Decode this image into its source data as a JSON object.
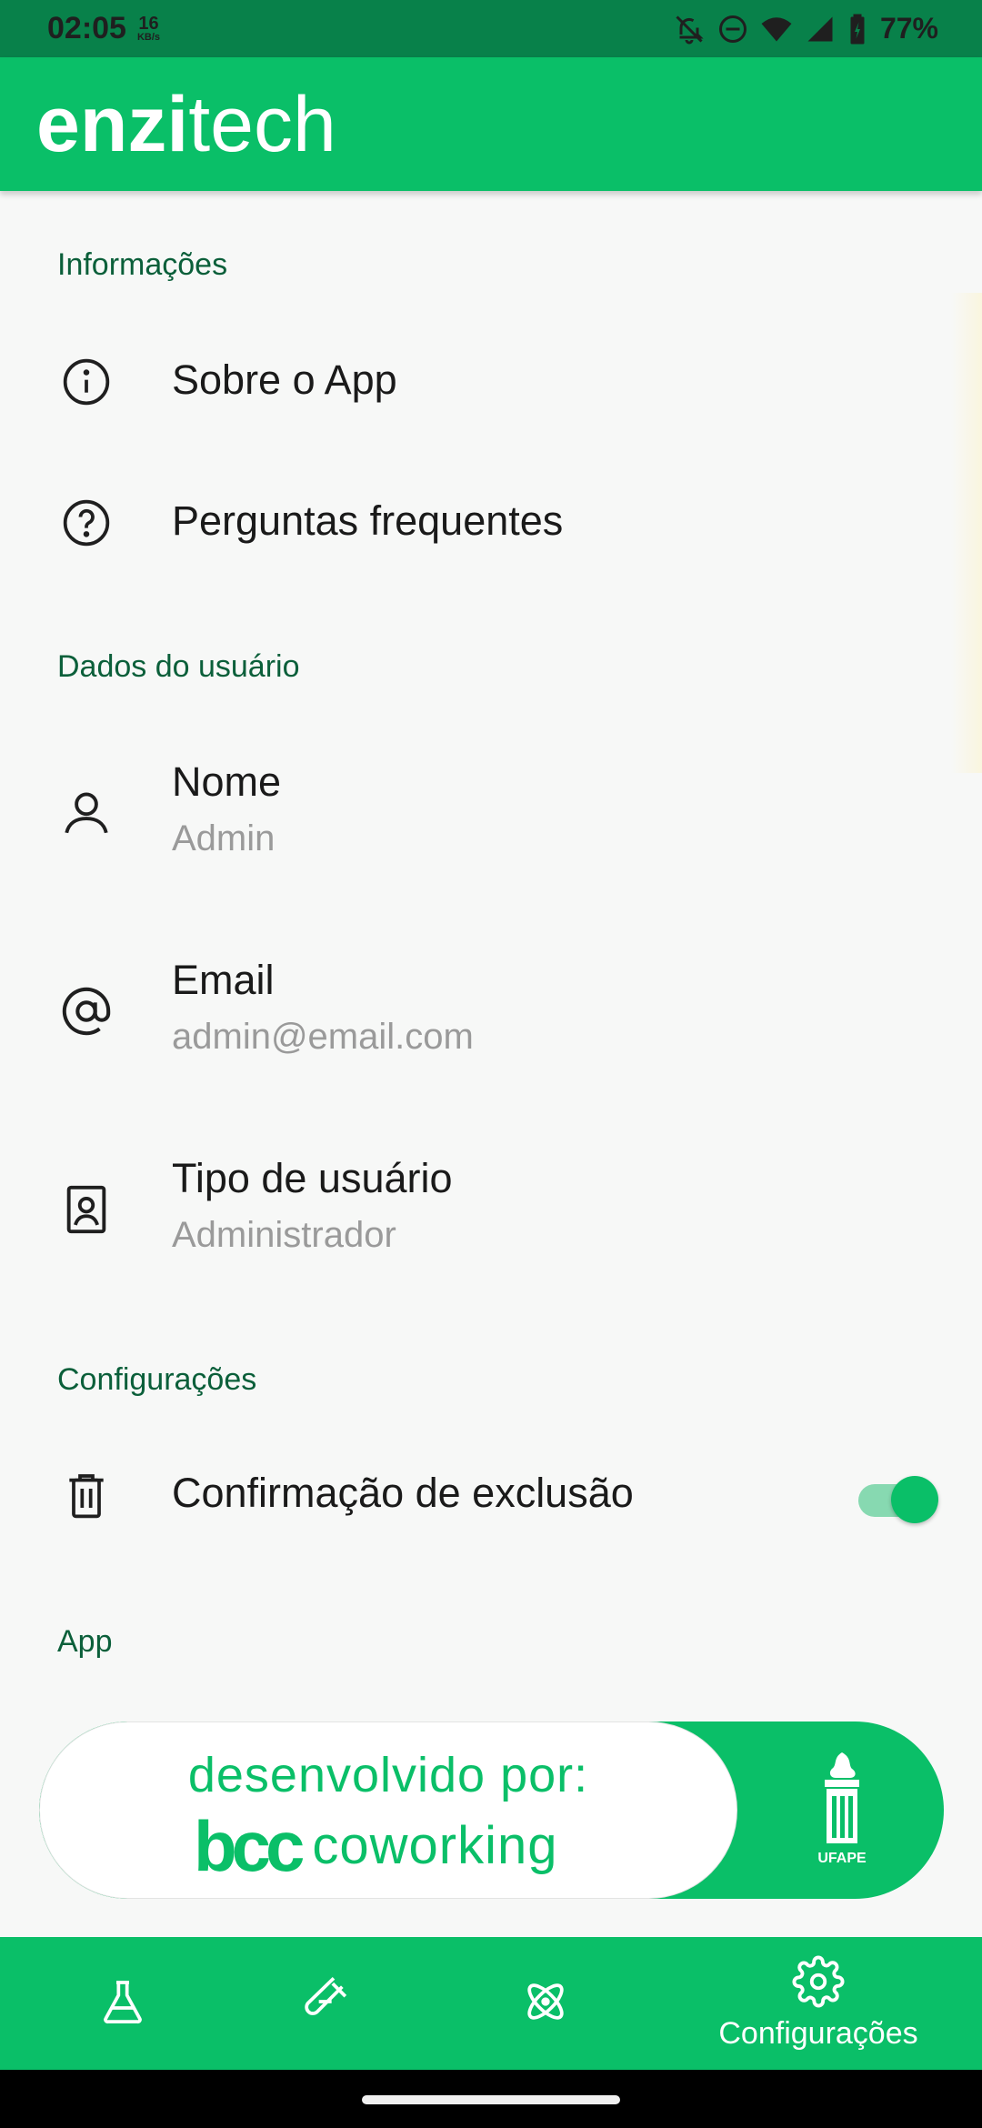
{
  "status_bar": {
    "time": "02:05",
    "net_speed_value": "16",
    "net_speed_unit": "KB/s",
    "battery": "77%",
    "icons": [
      "bell-off-icon",
      "dnd-icon",
      "wifi-icon",
      "signal-icon",
      "battery-icon"
    ]
  },
  "app_bar": {
    "brand_bold": "enzi",
    "brand_regular": "tech"
  },
  "sections": {
    "info": {
      "header": "Informações",
      "items": [
        {
          "title": "Sobre o App",
          "icon": "info-icon"
        },
        {
          "title": "Perguntas frequentes",
          "icon": "help-icon"
        }
      ]
    },
    "user": {
      "header": "Dados do usuário",
      "items": [
        {
          "title": "Nome",
          "subtitle": "Admin",
          "icon": "person-icon"
        },
        {
          "title": "Email",
          "subtitle": "admin@email.com",
          "icon": "at-sign-icon"
        },
        {
          "title": "Tipo de usuário",
          "subtitle": "Administrador",
          "icon": "badge-icon"
        }
      ]
    },
    "settings": {
      "header": "Configurações",
      "items": [
        {
          "title": "Confirmação de exclusão",
          "icon": "trash-icon",
          "toggle_on": true
        }
      ]
    },
    "app": {
      "header": "App"
    }
  },
  "banner": {
    "line1": "desenvolvido por:",
    "logo": "bcc",
    "line2": "coworking",
    "ufape_label": "UFAPE"
  },
  "bottom_nav": {
    "items": [
      {
        "icon": "flask-icon",
        "label": ""
      },
      {
        "icon": "test-tube-icon",
        "label": ""
      },
      {
        "icon": "atom-icon",
        "label": ""
      },
      {
        "icon": "gear-icon",
        "label": "Configurações",
        "active": true
      }
    ]
  },
  "colors": {
    "primary": "#0abf68",
    "status_bar": "#08814a",
    "section_header": "#0b5f3a",
    "subtitle": "#9a9a9a"
  }
}
